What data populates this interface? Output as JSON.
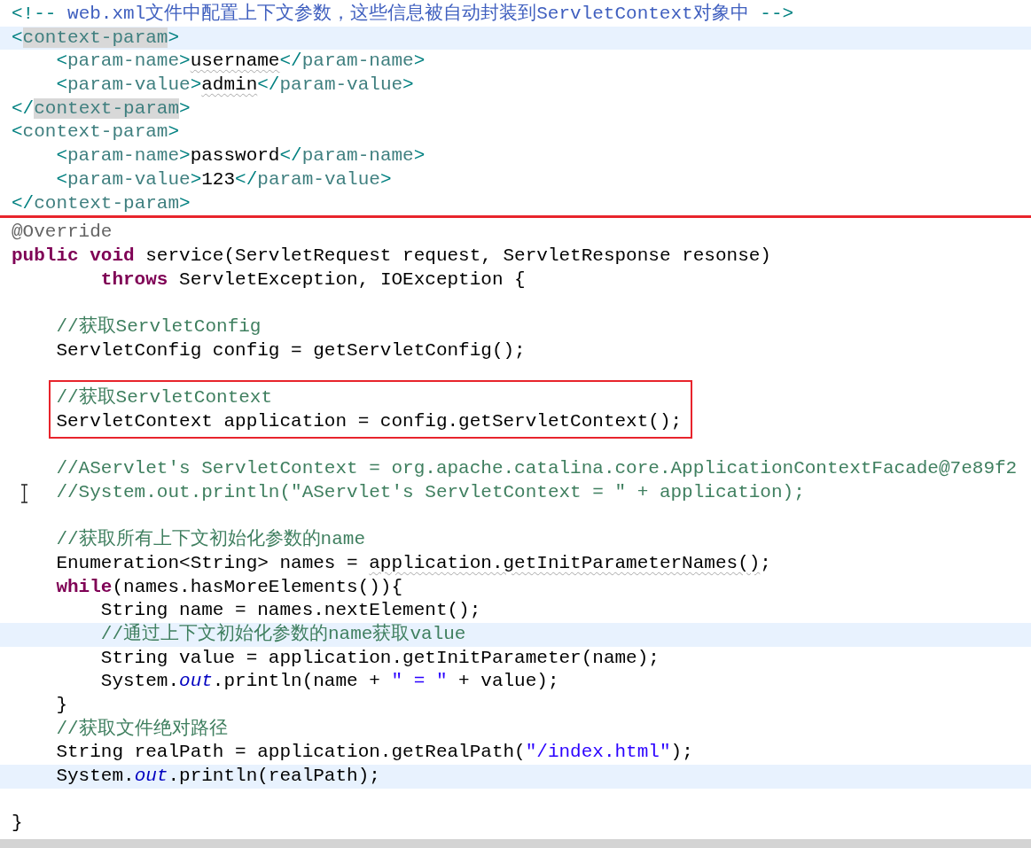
{
  "xml_editor": {
    "lines": [
      {
        "kind": "code",
        "highlighted": false,
        "tokens": [
          {
            "t": "<!--",
            "kind": "bracket"
          },
          {
            "t": " web.xml文件中配置上下文参数，这些信息被自动封装到ServletContext对象中 ",
            "kind": "xmlcomment"
          },
          {
            "t": "-->",
            "kind": "bracket"
          }
        ]
      },
      {
        "kind": "code",
        "highlighted": true,
        "tokens": [
          {
            "t": "<",
            "kind": "bracket"
          },
          {
            "t": "context-param",
            "kind": "tagname",
            "matched": true
          },
          {
            "t": ">",
            "kind": "bracket"
          }
        ]
      },
      {
        "kind": "code",
        "highlighted": false,
        "tokens": [
          {
            "t": "    <",
            "kind": "bracket"
          },
          {
            "t": "param-name",
            "kind": "tagname"
          },
          {
            "t": ">",
            "kind": "bracket"
          },
          {
            "t": "username",
            "kind": "text",
            "squiggle": true
          },
          {
            "t": "</",
            "kind": "bracket"
          },
          {
            "t": "param-name",
            "kind": "tagname"
          },
          {
            "t": ">",
            "kind": "bracket"
          }
        ]
      },
      {
        "kind": "code",
        "highlighted": false,
        "tokens": [
          {
            "t": "    <",
            "kind": "bracket"
          },
          {
            "t": "param-value",
            "kind": "tagname"
          },
          {
            "t": ">",
            "kind": "bracket"
          },
          {
            "t": "admin",
            "kind": "text",
            "squiggle": true
          },
          {
            "t": "</",
            "kind": "bracket"
          },
          {
            "t": "param-value",
            "kind": "tagname"
          },
          {
            "t": ">",
            "kind": "bracket"
          }
        ]
      },
      {
        "kind": "code",
        "highlighted": false,
        "tokens": [
          {
            "t": "</",
            "kind": "bracket"
          },
          {
            "t": "context-param",
            "kind": "tagname",
            "matched": true
          },
          {
            "t": ">",
            "kind": "bracket"
          }
        ]
      },
      {
        "kind": "code",
        "highlighted": false,
        "tokens": [
          {
            "t": "<",
            "kind": "bracket"
          },
          {
            "t": "context-param",
            "kind": "tagname"
          },
          {
            "t": ">",
            "kind": "bracket"
          }
        ]
      },
      {
        "kind": "code",
        "highlighted": false,
        "tokens": [
          {
            "t": "    <",
            "kind": "bracket"
          },
          {
            "t": "param-name",
            "kind": "tagname"
          },
          {
            "t": ">",
            "kind": "bracket"
          },
          {
            "t": "password",
            "kind": "text"
          },
          {
            "t": "</",
            "kind": "bracket"
          },
          {
            "t": "param-name",
            "kind": "tagname"
          },
          {
            "t": ">",
            "kind": "bracket"
          }
        ]
      },
      {
        "kind": "code",
        "highlighted": false,
        "tokens": [
          {
            "t": "    <",
            "kind": "bracket"
          },
          {
            "t": "param-value",
            "kind": "tagname"
          },
          {
            "t": ">",
            "kind": "bracket"
          },
          {
            "t": "123",
            "kind": "text"
          },
          {
            "t": "</",
            "kind": "bracket"
          },
          {
            "t": "param-value",
            "kind": "tagname"
          },
          {
            "t": ">",
            "kind": "bracket"
          }
        ]
      },
      {
        "kind": "code",
        "highlighted": false,
        "tokens": [
          {
            "t": "</",
            "kind": "bracket"
          },
          {
            "t": "context-param",
            "kind": "tagname"
          },
          {
            "t": ">",
            "kind": "bracket"
          }
        ]
      }
    ]
  },
  "java_editor": {
    "lines": [
      {
        "kind": "code",
        "highlighted": false,
        "tokens": [
          {
            "t": "@Override",
            "kind": "annotation"
          }
        ]
      },
      {
        "kind": "code",
        "highlighted": false,
        "tokens": [
          {
            "t": "public void",
            "kind": "keyword"
          },
          {
            "t": " service(ServletRequest request, ServletResponse resonse)",
            "kind": "plain"
          }
        ]
      },
      {
        "kind": "code",
        "highlighted": false,
        "tokens": [
          {
            "t": "        throws",
            "kind": "keyword"
          },
          {
            "t": " ServletException, IOException {",
            "kind": "plain"
          }
        ]
      },
      {
        "kind": "blank"
      },
      {
        "kind": "code",
        "highlighted": false,
        "tokens": [
          {
            "t": "    //获取ServletConfig",
            "kind": "comment"
          }
        ]
      },
      {
        "kind": "code",
        "highlighted": false,
        "tokens": [
          {
            "t": "    ServletConfig config = getServletConfig();",
            "kind": "plain"
          }
        ]
      },
      {
        "kind": "blank"
      },
      {
        "kind": "box",
        "lines": [
          {
            "kind": "code",
            "highlighted": false,
            "tokens": [
              {
                "t": "    //获取ServletContext",
                "kind": "comment"
              }
            ]
          },
          {
            "kind": "code",
            "highlighted": false,
            "tokens": [
              {
                "t": "    ServletContext application = config.getServletContext();",
                "kind": "plain"
              }
            ]
          }
        ]
      },
      {
        "kind": "blank"
      },
      {
        "kind": "code",
        "highlighted": false,
        "tokens": [
          {
            "t": "    //AServlet's ServletContext = org.apache.catalina.core.ApplicationContextFacade@7e89f2",
            "kind": "comment"
          }
        ]
      },
      {
        "kind": "code",
        "highlighted": false,
        "cursor": true,
        "tokens": [
          {
            "t": "    //System.out.println(\"AServlet's ServletContext = \" + application);",
            "kind": "comment"
          }
        ]
      },
      {
        "kind": "blank"
      },
      {
        "kind": "code",
        "highlighted": false,
        "tokens": [
          {
            "t": "    //获取所有上下文初始化参数的name",
            "kind": "comment"
          }
        ]
      },
      {
        "kind": "code",
        "highlighted": false,
        "tokens": [
          {
            "t": "    Enumeration<String> names = ",
            "kind": "plain"
          },
          {
            "t": "application.getInitParameterNames()",
            "kind": "plain",
            "squiggle": true
          },
          {
            "t": ";",
            "kind": "plain"
          }
        ]
      },
      {
        "kind": "code",
        "highlighted": false,
        "tokens": [
          {
            "t": "    while",
            "kind": "keyword"
          },
          {
            "t": "(names.hasMoreElements()){",
            "kind": "plain"
          }
        ]
      },
      {
        "kind": "code",
        "highlighted": false,
        "tokens": [
          {
            "t": "        String name = names.nextElement();",
            "kind": "plain"
          }
        ]
      },
      {
        "kind": "code",
        "highlighted": true,
        "tokens": [
          {
            "t": "        //通过上下文初始化参数的name获取value",
            "kind": "comment"
          }
        ]
      },
      {
        "kind": "code",
        "highlighted": false,
        "tokens": [
          {
            "t": "        String value = application.getInitParameter(name);",
            "kind": "plain"
          }
        ]
      },
      {
        "kind": "code",
        "highlighted": false,
        "tokens": [
          {
            "t": "        System.",
            "kind": "plain"
          },
          {
            "t": "out",
            "kind": "field"
          },
          {
            "t": ".println(name + ",
            "kind": "plain"
          },
          {
            "t": "\" = \"",
            "kind": "string"
          },
          {
            "t": " + value);",
            "kind": "plain"
          }
        ]
      },
      {
        "kind": "code",
        "highlighted": false,
        "tokens": [
          {
            "t": "    }",
            "kind": "plain"
          }
        ]
      },
      {
        "kind": "code",
        "highlighted": false,
        "tokens": [
          {
            "t": "    //获取文件绝对路径",
            "kind": "comment"
          }
        ]
      },
      {
        "kind": "code",
        "highlighted": false,
        "tokens": [
          {
            "t": "    String realPath = application.getRealPath(",
            "kind": "plain"
          },
          {
            "t": "\"/index.html\"",
            "kind": "string"
          },
          {
            "t": ");",
            "kind": "plain"
          }
        ]
      },
      {
        "kind": "code",
        "highlighted": true,
        "tokens": [
          {
            "t": "    System.",
            "kind": "plain"
          },
          {
            "t": "out",
            "kind": "field"
          },
          {
            "t": ".println(realPath);",
            "kind": "plain"
          }
        ]
      },
      {
        "kind": "blank"
      },
      {
        "kind": "code",
        "highlighted": false,
        "tokens": [
          {
            "t": "}",
            "kind": "plain"
          }
        ]
      }
    ]
  }
}
